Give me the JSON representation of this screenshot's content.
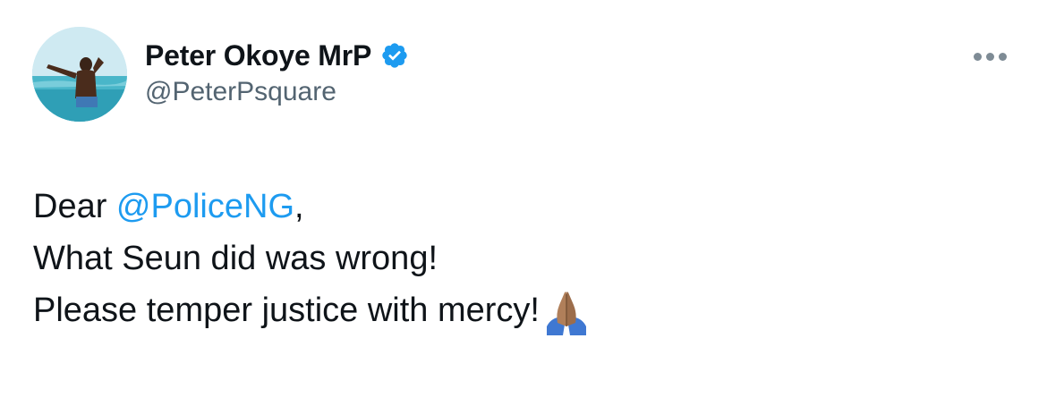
{
  "author": {
    "display_name": "Peter Okoye MrP",
    "handle": "@PeterPsquare",
    "verified": true,
    "verified_color": "#1d9bf0"
  },
  "avatar": {
    "icon": "profile-photo"
  },
  "more_options": {
    "icon": "more-horizontal-icon"
  },
  "tweet": {
    "line1_prefix": "Dear ",
    "mention": "@PoliceNG",
    "line1_suffix": ",",
    "line2": "What Seun did was wrong!",
    "line3": "Please temper justice with mercy!",
    "emoji": "folded-hands-emoji"
  },
  "colors": {
    "text": "#0f1419",
    "secondary_text": "#536471",
    "link": "#1d9bf0"
  }
}
